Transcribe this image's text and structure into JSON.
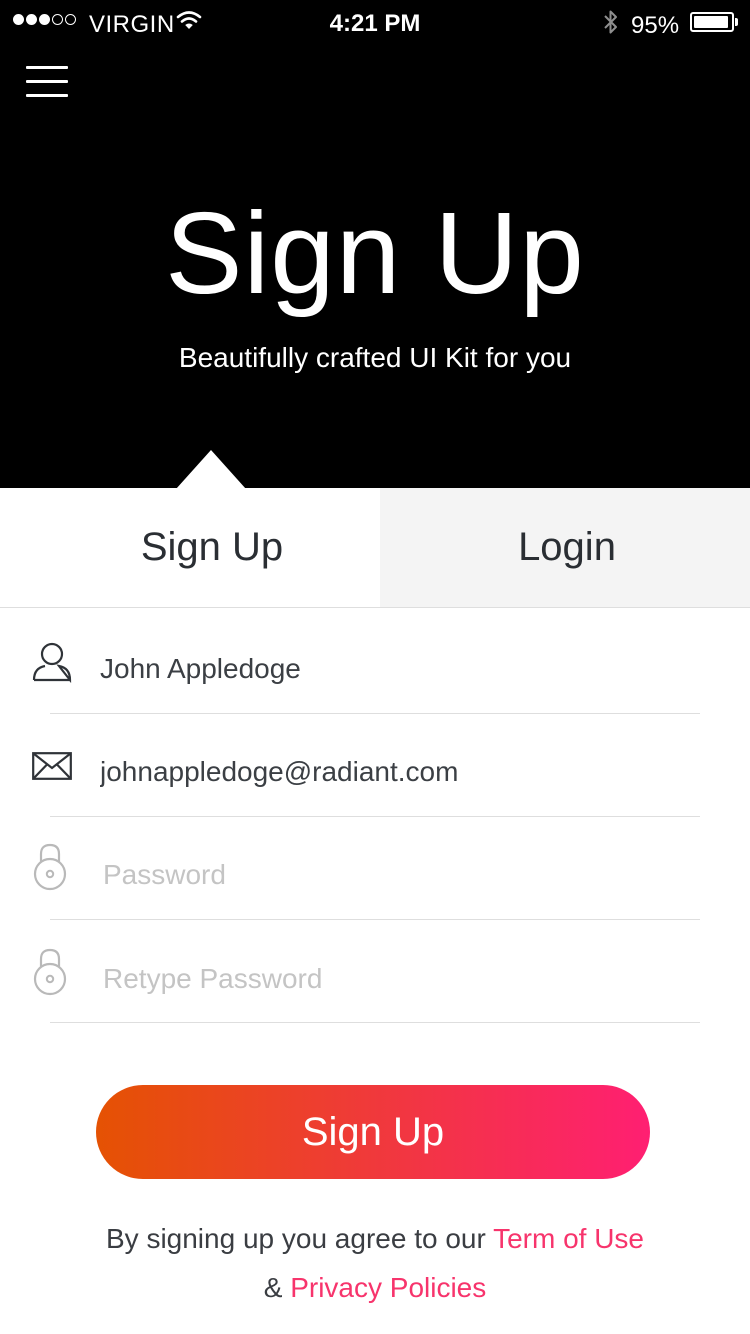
{
  "status_bar": {
    "carrier": "VIRGIN",
    "time": "4:21 PM",
    "battery": "95%",
    "battery_level": 0.95,
    "signal_bars_filled": 3,
    "signal_bars_total": 5
  },
  "header": {
    "menu_icon": "hamburger-menu-icon",
    "title": "Sign Up",
    "subtitle": "Beautifully crafted UI Kit for you"
  },
  "tabs": [
    {
      "label": "Sign Up",
      "active": true
    },
    {
      "label": "Login",
      "active": false
    }
  ],
  "form": {
    "name": {
      "icon": "user-icon",
      "value": "John Appledoge",
      "placeholder": ""
    },
    "email": {
      "icon": "envelope-icon",
      "value": "johnappledoge@radiant.com",
      "placeholder": ""
    },
    "password": {
      "icon": "lock-icon",
      "value": "",
      "placeholder": "Password"
    },
    "retype_password": {
      "icon": "lock-icon",
      "value": "",
      "placeholder": "Retype Password"
    }
  },
  "signup_button": {
    "label": "Sign Up"
  },
  "terms": {
    "prefix": "By signing up you agree to our",
    "terms_link": "Term of Use",
    "joiner": "&",
    "privacy_link": "Privacy Policies"
  },
  "colors": {
    "header_bg": "#000000",
    "button_gradient_start": "#e55203",
    "button_gradient_end": "#ff1f72",
    "link": "#f7346c",
    "inactive_tab_bg": "#f4f4f4"
  }
}
